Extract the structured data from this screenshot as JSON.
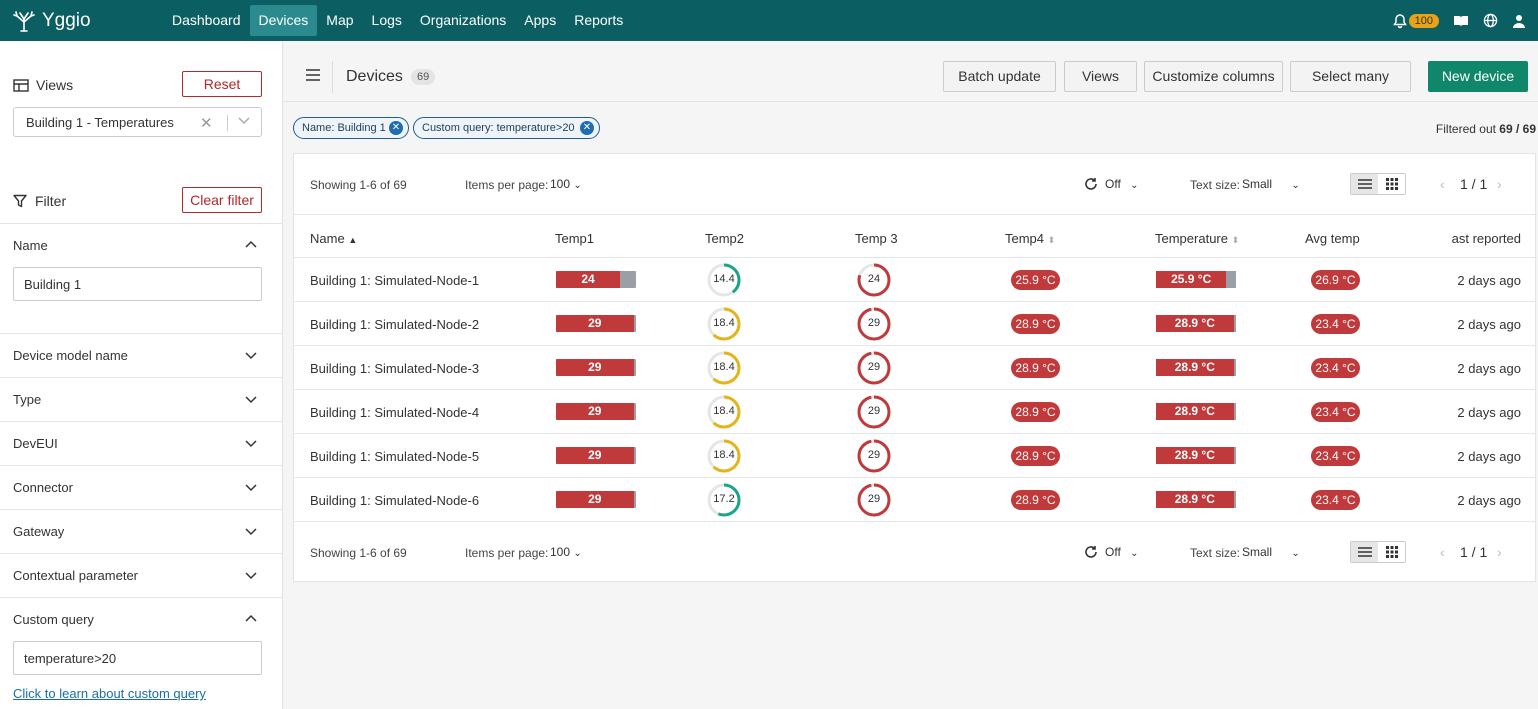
{
  "app": {
    "name": "Yggio"
  },
  "nav": {
    "items": [
      "Dashboard",
      "Devices",
      "Map",
      "Logs",
      "Organizations",
      "Apps",
      "Reports"
    ],
    "active": "Devices",
    "notification_count": "100"
  },
  "sidebar": {
    "views_title": "Views",
    "reset_label": "Reset",
    "view_selected": "Building 1 - Temperatures",
    "filter_title": "Filter",
    "clear_filter_label": "Clear filter",
    "filters": {
      "name": {
        "label": "Name",
        "value": "Building 1"
      },
      "device_model": {
        "label": "Device model name"
      },
      "type": {
        "label": "Type"
      },
      "deveui": {
        "label": "DevEUI"
      },
      "connector": {
        "label": "Connector"
      },
      "gateway": {
        "label": "Gateway"
      },
      "contextual": {
        "label": "Contextual parameter"
      },
      "custom_query": {
        "label": "Custom query",
        "value": "temperature>20"
      }
    },
    "learn_link": "Click to learn about custom query"
  },
  "header": {
    "title": "Devices",
    "count": "69",
    "batch_update": "Batch update",
    "views": "Views",
    "customize_columns": "Customize columns",
    "select_many": "Select many",
    "new_device": "New device"
  },
  "chips": [
    "Name: Building 1",
    "Custom query: temperature>20"
  ],
  "filtered_out": {
    "label": "Filtered out",
    "value": "69 / 69"
  },
  "toolbar": {
    "showing": "Showing 1-6 of 69",
    "items_per_page_label": "Items per page:",
    "items_per_page": "100",
    "refresh": "Off",
    "text_size_label": "Text size:",
    "text_size": "Small",
    "page": "1 / 1"
  },
  "columns": [
    "Name",
    "Temp1",
    "Temp2",
    "Temp 3",
    "Temp4",
    "Temperature",
    "Avg temp",
    "ast reported"
  ],
  "rows": [
    {
      "name": "Building 1: Simulated-Node-1",
      "temp1": "24",
      "temp1_pct": 0.8,
      "temp2": "14.4",
      "temp2_pct": 0.4,
      "temp2_color": "#1aa58a",
      "temp3": "24",
      "temp3_pct": 0.8,
      "temp4": "25.9 °C",
      "temperature": "25.9 °C",
      "temperature_pct": 0.88,
      "avg": "26.9 °C",
      "reported": "2 days ago"
    },
    {
      "name": "Building 1: Simulated-Node-2",
      "temp1": "29",
      "temp1_pct": 0.97,
      "temp2": "18.4",
      "temp2_pct": 0.62,
      "temp2_color": "#e6b41a",
      "temp3": "29",
      "temp3_pct": 0.97,
      "temp4": "28.9 °C",
      "temperature": "28.9 °C",
      "temperature_pct": 0.97,
      "avg": "23.4 °C",
      "reported": "2 days ago"
    },
    {
      "name": "Building 1: Simulated-Node-3",
      "temp1": "29",
      "temp1_pct": 0.97,
      "temp2": "18.4",
      "temp2_pct": 0.62,
      "temp2_color": "#e6b41a",
      "temp3": "29",
      "temp3_pct": 0.97,
      "temp4": "28.9 °C",
      "temperature": "28.9 °C",
      "temperature_pct": 0.97,
      "avg": "23.4 °C",
      "reported": "2 days ago"
    },
    {
      "name": "Building 1: Simulated-Node-4",
      "temp1": "29",
      "temp1_pct": 0.97,
      "temp2": "18.4",
      "temp2_pct": 0.62,
      "temp2_color": "#e6b41a",
      "temp3": "29",
      "temp3_pct": 0.97,
      "temp4": "28.9 °C",
      "temperature": "28.9 °C",
      "temperature_pct": 0.97,
      "avg": "23.4 °C",
      "reported": "2 days ago"
    },
    {
      "name": "Building 1: Simulated-Node-5",
      "temp1": "29",
      "temp1_pct": 0.97,
      "temp2": "18.4",
      "temp2_pct": 0.62,
      "temp2_color": "#e6b41a",
      "temp3": "29",
      "temp3_pct": 0.97,
      "temp4": "28.9 °C",
      "temperature": "28.9 °C",
      "temperature_pct": 0.97,
      "avg": "23.4 °C",
      "reported": "2 days ago"
    },
    {
      "name": "Building 1: Simulated-Node-6",
      "temp1": "29",
      "temp1_pct": 0.97,
      "temp2": "17.2",
      "temp2_pct": 0.56,
      "temp2_color": "#1aa58a",
      "temp3": "29",
      "temp3_pct": 0.97,
      "temp4": "28.9 °C",
      "temperature": "28.9 °C",
      "temperature_pct": 0.97,
      "avg": "23.4 °C",
      "reported": "2 days ago"
    }
  ],
  "colors": {
    "topbar": "#0b5f63",
    "active_nav": "#2a8a8e",
    "danger": "#c0393b",
    "primary": "#10876b"
  },
  "icons": [
    "tree-logo-icon",
    "bell-icon",
    "book-icon",
    "globe-icon",
    "user-icon",
    "table-icon",
    "filter-icon",
    "hamburger-icon",
    "refresh-icon",
    "list-view-icon",
    "grid-view-icon"
  ]
}
